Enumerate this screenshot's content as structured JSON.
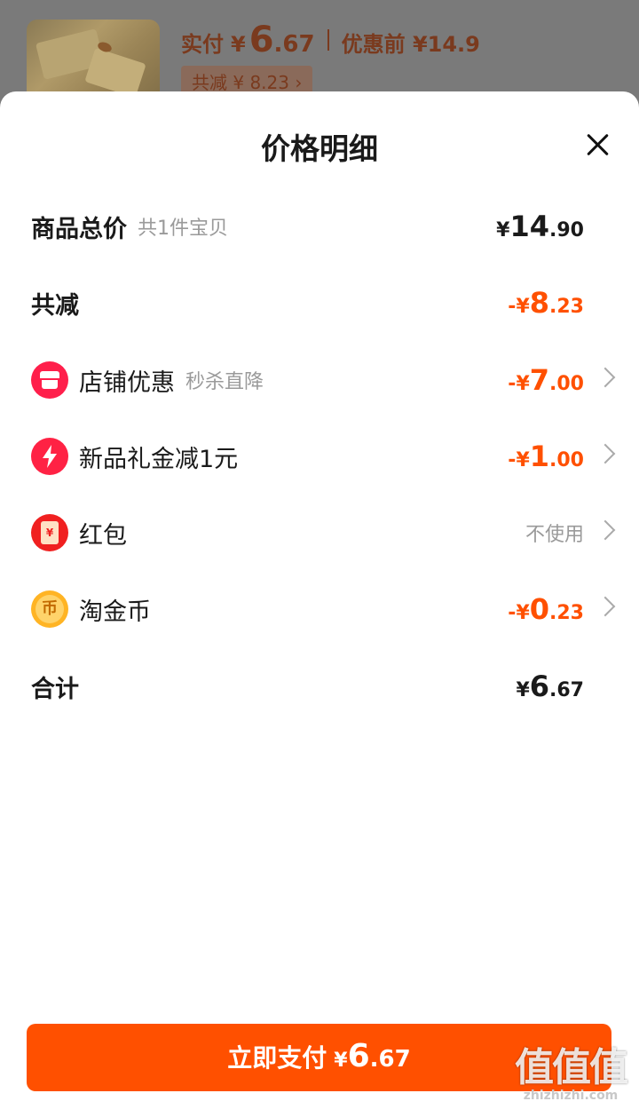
{
  "background": {
    "actual_pay_label": "实付",
    "actual_pay_yen": "¥",
    "actual_pay_int": "6",
    "actual_pay_dec": ".67",
    "original_price": "优惠前 ¥14.9",
    "discount_badge": "共减 ¥ 8.23 ›"
  },
  "sheet": {
    "title": "价格明细",
    "close_icon": "close-icon"
  },
  "rows": {
    "total": {
      "label": "商品总价",
      "sub": "共1件宝贝",
      "yen": "¥",
      "int": "14",
      "dec": ".90"
    },
    "reduce": {
      "label": "共减",
      "sign": "-",
      "yen": "¥",
      "int": "8",
      "dec": ".23"
    },
    "shop": {
      "icon": "shop-icon",
      "label": "店铺优惠",
      "sub": "秒杀直降",
      "sign": "-",
      "yen": "¥",
      "int": "7",
      "dec": ".00"
    },
    "gift": {
      "icon": "lightning-icon",
      "label": "新品礼金减1元",
      "sign": "-",
      "yen": "¥",
      "int": "1",
      "dec": ".00"
    },
    "redpacket": {
      "icon": "red-envelope-icon",
      "label": "红包",
      "value": "不使用"
    },
    "coin": {
      "icon": "coin-icon",
      "label": "淘金币",
      "sign": "-",
      "yen": "¥",
      "int": "0",
      "dec": ".23"
    },
    "sum": {
      "label": "合计",
      "yen": "¥",
      "int": "6",
      "dec": ".67"
    }
  },
  "pay_button": {
    "label": "立即支付",
    "yen": "¥",
    "int": "6",
    "dec": ".67"
  },
  "watermark": {
    "big": "值值值",
    "small": "zhizhizhi.com"
  },
  "colors": {
    "accent": "#ff5000",
    "text": "#1a1a1a",
    "muted": "#9a9a9a"
  }
}
